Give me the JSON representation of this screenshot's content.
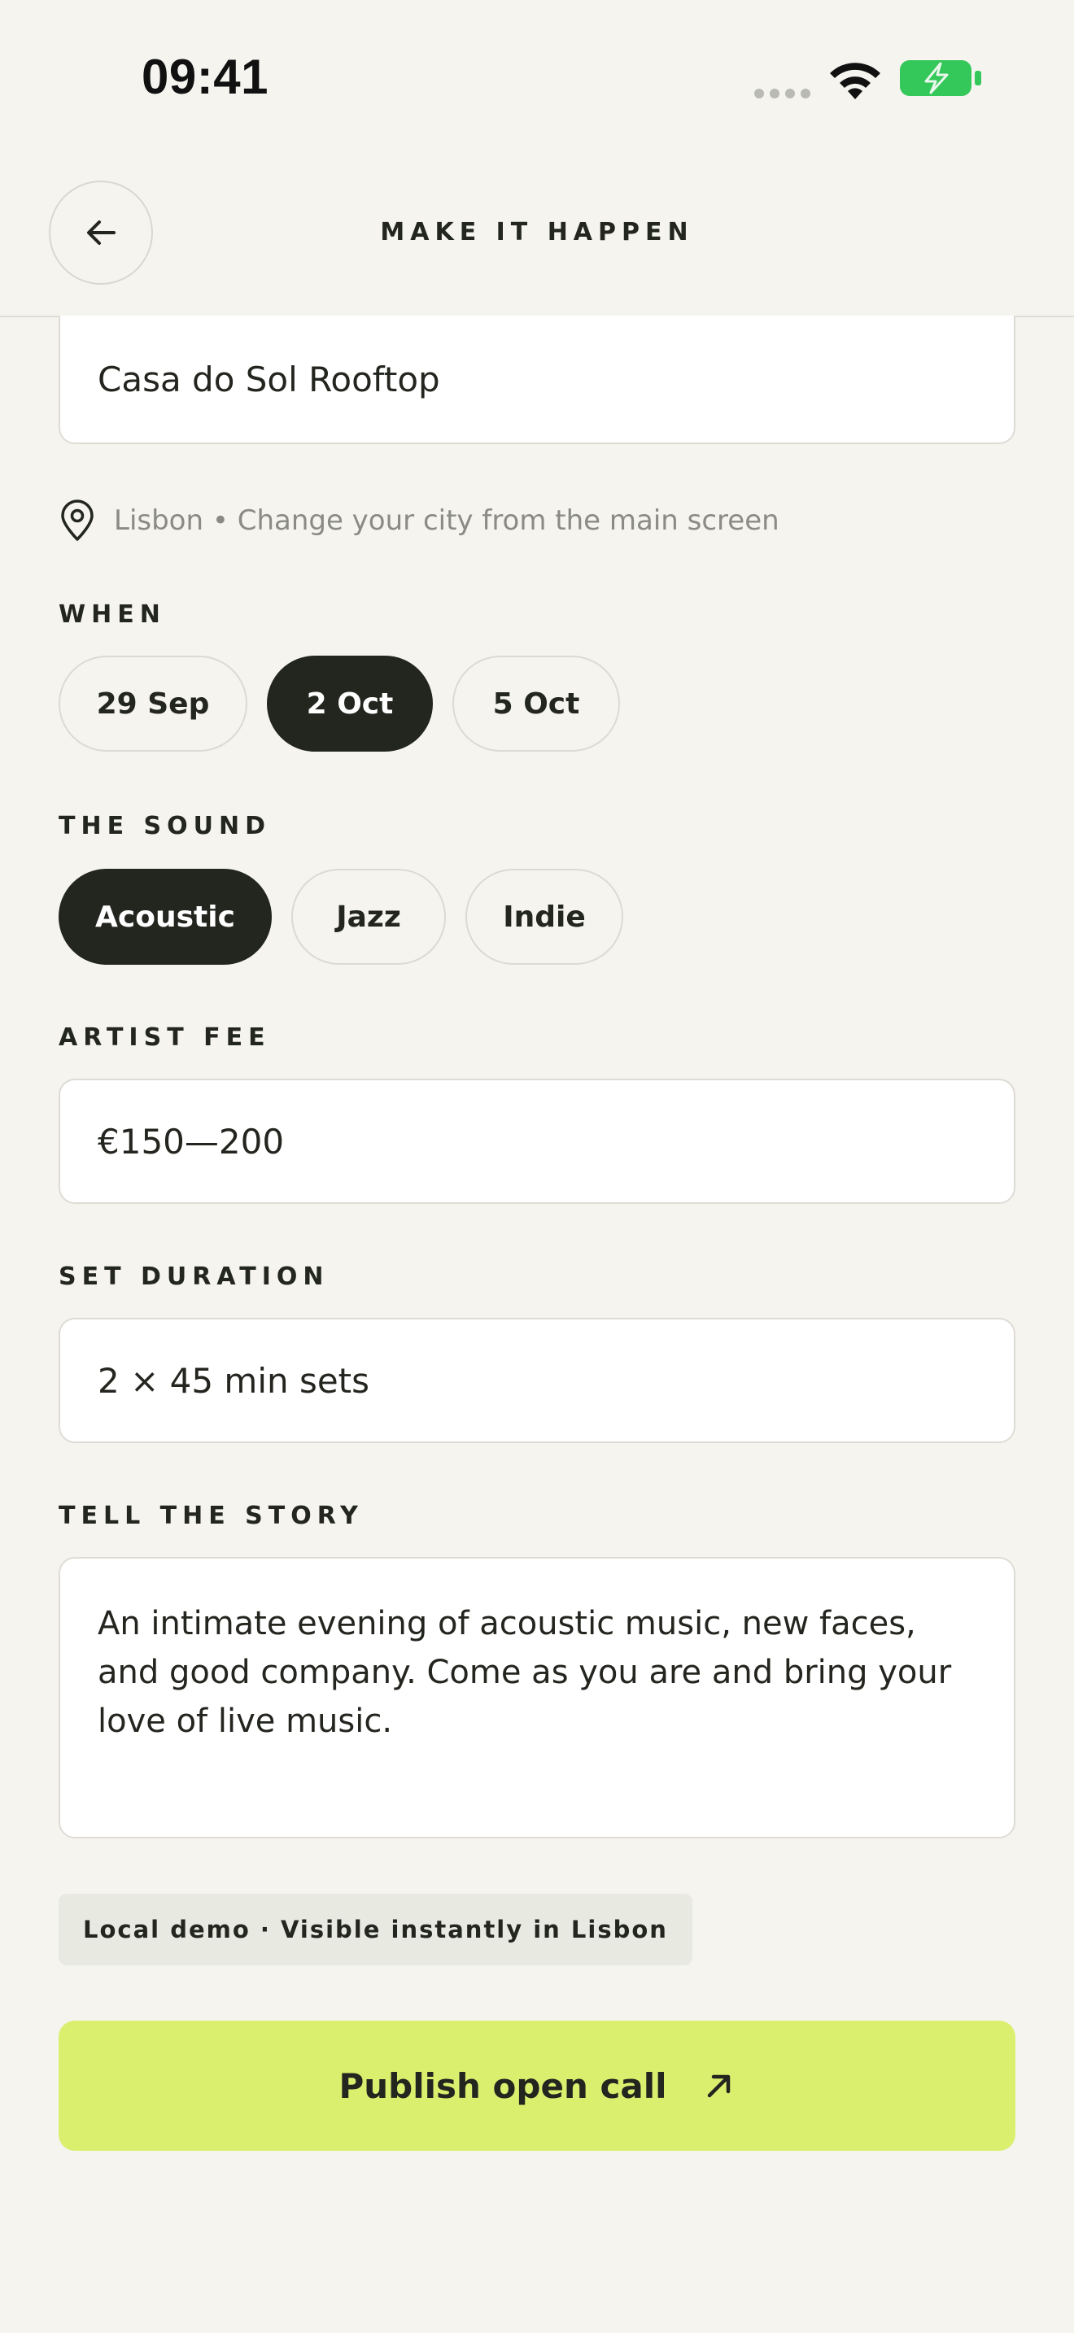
{
  "status_bar": {
    "time": "09:41",
    "battery_color": "#34c759"
  },
  "header": {
    "title": "MAKE IT HAPPEN",
    "back_icon": "arrow-left-icon"
  },
  "venue": {
    "value": "Casa do Sol Rooftop"
  },
  "location_hint": {
    "icon": "map-pin-icon",
    "text": "Lisbon • Change your city from the main screen"
  },
  "when": {
    "label": "WHEN",
    "options": [
      "29 Sep",
      "2 Oct",
      "5 Oct"
    ],
    "selected": "2 Oct"
  },
  "sound": {
    "label": "THE SOUND",
    "options": [
      "Acoustic",
      "Jazz",
      "Indie"
    ],
    "selected": "Acoustic"
  },
  "artist_fee": {
    "label": "ARTIST FEE",
    "value": "€150—200"
  },
  "set_duration": {
    "label": "SET DURATION",
    "value": "2 × 45 min sets"
  },
  "story": {
    "label": "TELL THE STORY",
    "value": "An intimate evening of acoustic music, new faces, and good company. Come as you are and bring your love of live music."
  },
  "demo_badge": {
    "text": "Local demo · Visible instantly in Lisbon"
  },
  "publish": {
    "label": "Publish open call",
    "icon": "arrow-up-right-icon",
    "color": "#dbef6f"
  },
  "colors": {
    "background": "#f5f4ef",
    "dark": "#23251f",
    "accent": "#dbef6f"
  }
}
